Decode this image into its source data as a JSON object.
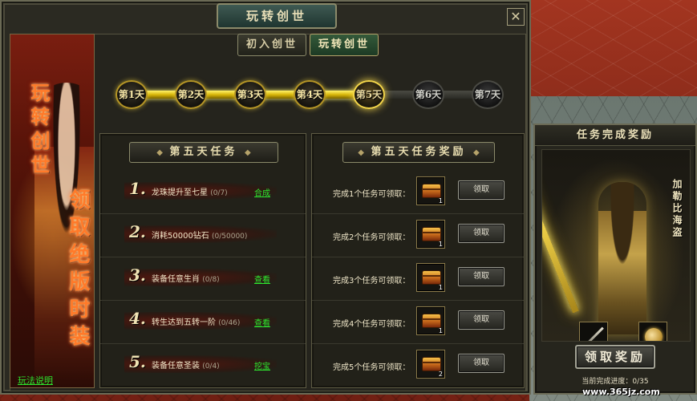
{
  "window": {
    "title": "玩转创世",
    "close_icon": "close-icon"
  },
  "left_banner": {
    "line1": "玩转创世",
    "line2": "领取绝版时装",
    "help_link": "玩法说明"
  },
  "tabs": [
    {
      "label": "初入创世",
      "active": false
    },
    {
      "label": "玩转创世",
      "active": true
    }
  ],
  "days": [
    {
      "label": "第1天",
      "state": "lit"
    },
    {
      "label": "第2天",
      "state": "lit"
    },
    {
      "label": "第3天",
      "state": "lit"
    },
    {
      "label": "第4天",
      "state": "lit"
    },
    {
      "label": "第5天",
      "state": "current"
    },
    {
      "label": "第6天",
      "state": "locked"
    },
    {
      "label": "第7天",
      "state": "locked"
    }
  ],
  "task_panel": {
    "title": "第五天任务",
    "tasks": [
      {
        "num": "1.",
        "name": "龙珠提升至七星",
        "progress": "(0/7)",
        "action": "合成"
      },
      {
        "num": "2.",
        "name": "消耗50000钻石",
        "progress": "(0/50000)",
        "action": ""
      },
      {
        "num": "3.",
        "name": "装备任意生肖",
        "progress": "(0/8)",
        "action": "查看"
      },
      {
        "num": "4.",
        "name": "转生达到五转一阶",
        "progress": "(0/46)",
        "action": "查看"
      },
      {
        "num": "5.",
        "name": "装备任意圣装",
        "progress": "(0/4)",
        "action": "挖宝"
      }
    ]
  },
  "reward_panel": {
    "title": "第五天任务奖励",
    "rows": [
      {
        "label": "完成1个任务可领取：",
        "qty": "1",
        "button": "领取"
      },
      {
        "label": "完成2个任务可领取：",
        "qty": "1",
        "button": "领取"
      },
      {
        "label": "完成3个任务可领取：",
        "qty": "1",
        "button": "领取"
      },
      {
        "label": "完成4个任务可领取：",
        "qty": "1",
        "button": "领取"
      },
      {
        "label": "完成5个任务可领取：",
        "qty": "2",
        "button": "领取"
      }
    ]
  },
  "side_window": {
    "title": "任务完成奖励",
    "reward_name": "加勒比海盗",
    "claim_button": "领取奖励",
    "progress_label": "当前完成进度：0/35"
  },
  "watermark": "www.365jz.com",
  "colors": {
    "accent_gold": "#f3d54a",
    "link_green": "#2ee62e",
    "text_light": "#efe6c8"
  }
}
